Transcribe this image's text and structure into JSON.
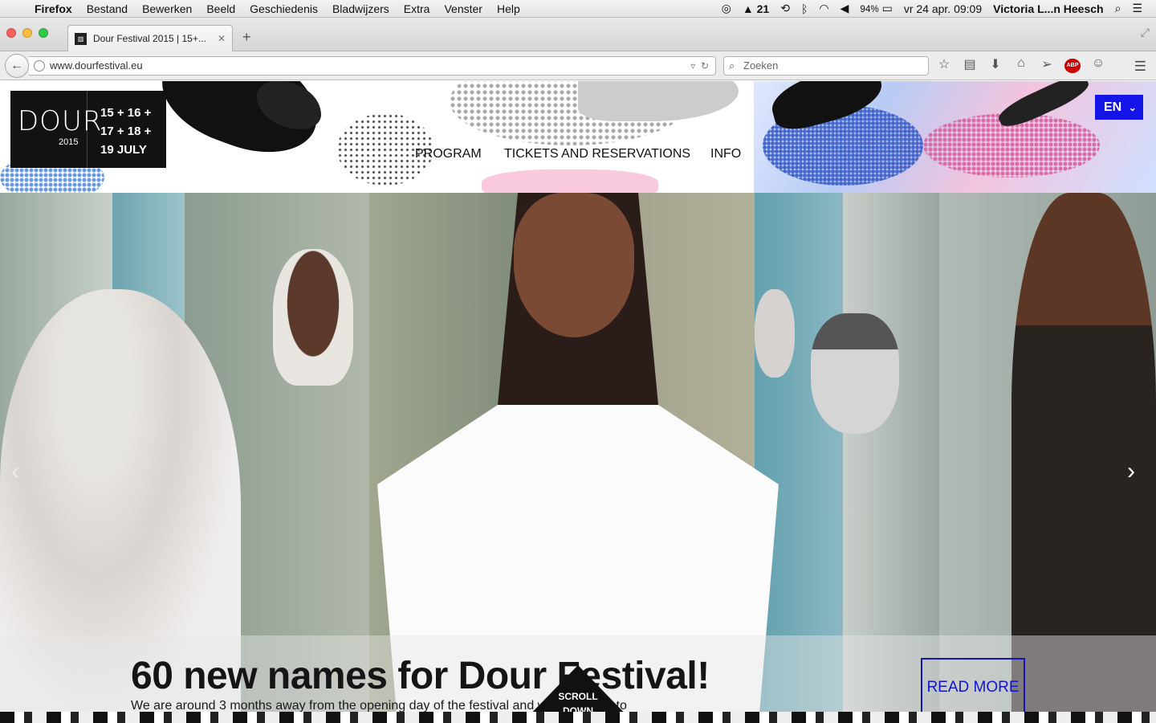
{
  "menubar": {
    "app": "Firefox",
    "menus": [
      "Bestand",
      "Bewerken",
      "Beeld",
      "Geschiedenis",
      "Bladwijzers",
      "Extra",
      "Venster",
      "Help"
    ],
    "status_count": "21",
    "battery": "94%",
    "datetime": "vr 24 apr.  09:09",
    "user": "Victoria L...n Heesch"
  },
  "browser": {
    "tab_title": "Dour Festival 2015 | 15+...",
    "url": "www.dourfestival.eu",
    "search_placeholder": "Zoeken"
  },
  "site": {
    "logo_word": "DOUR",
    "logo_year": "2015",
    "dates": [
      "15 + 16 +",
      "17 + 18 +",
      "19  JULY"
    ],
    "nav": [
      "PROGRAM",
      "TICKETS AND RESERVATIONS",
      "INFO"
    ],
    "language": "EN",
    "accent_color": "#1414e6"
  },
  "hero": {
    "headline": "60 new names for Dour Festival!",
    "teaser": "We are around 3 months away from the opening day of the festival and we are proud to",
    "read_more": "READ MORE",
    "scroll_label_1": "SCROLL",
    "scroll_label_2": "DOWN"
  }
}
